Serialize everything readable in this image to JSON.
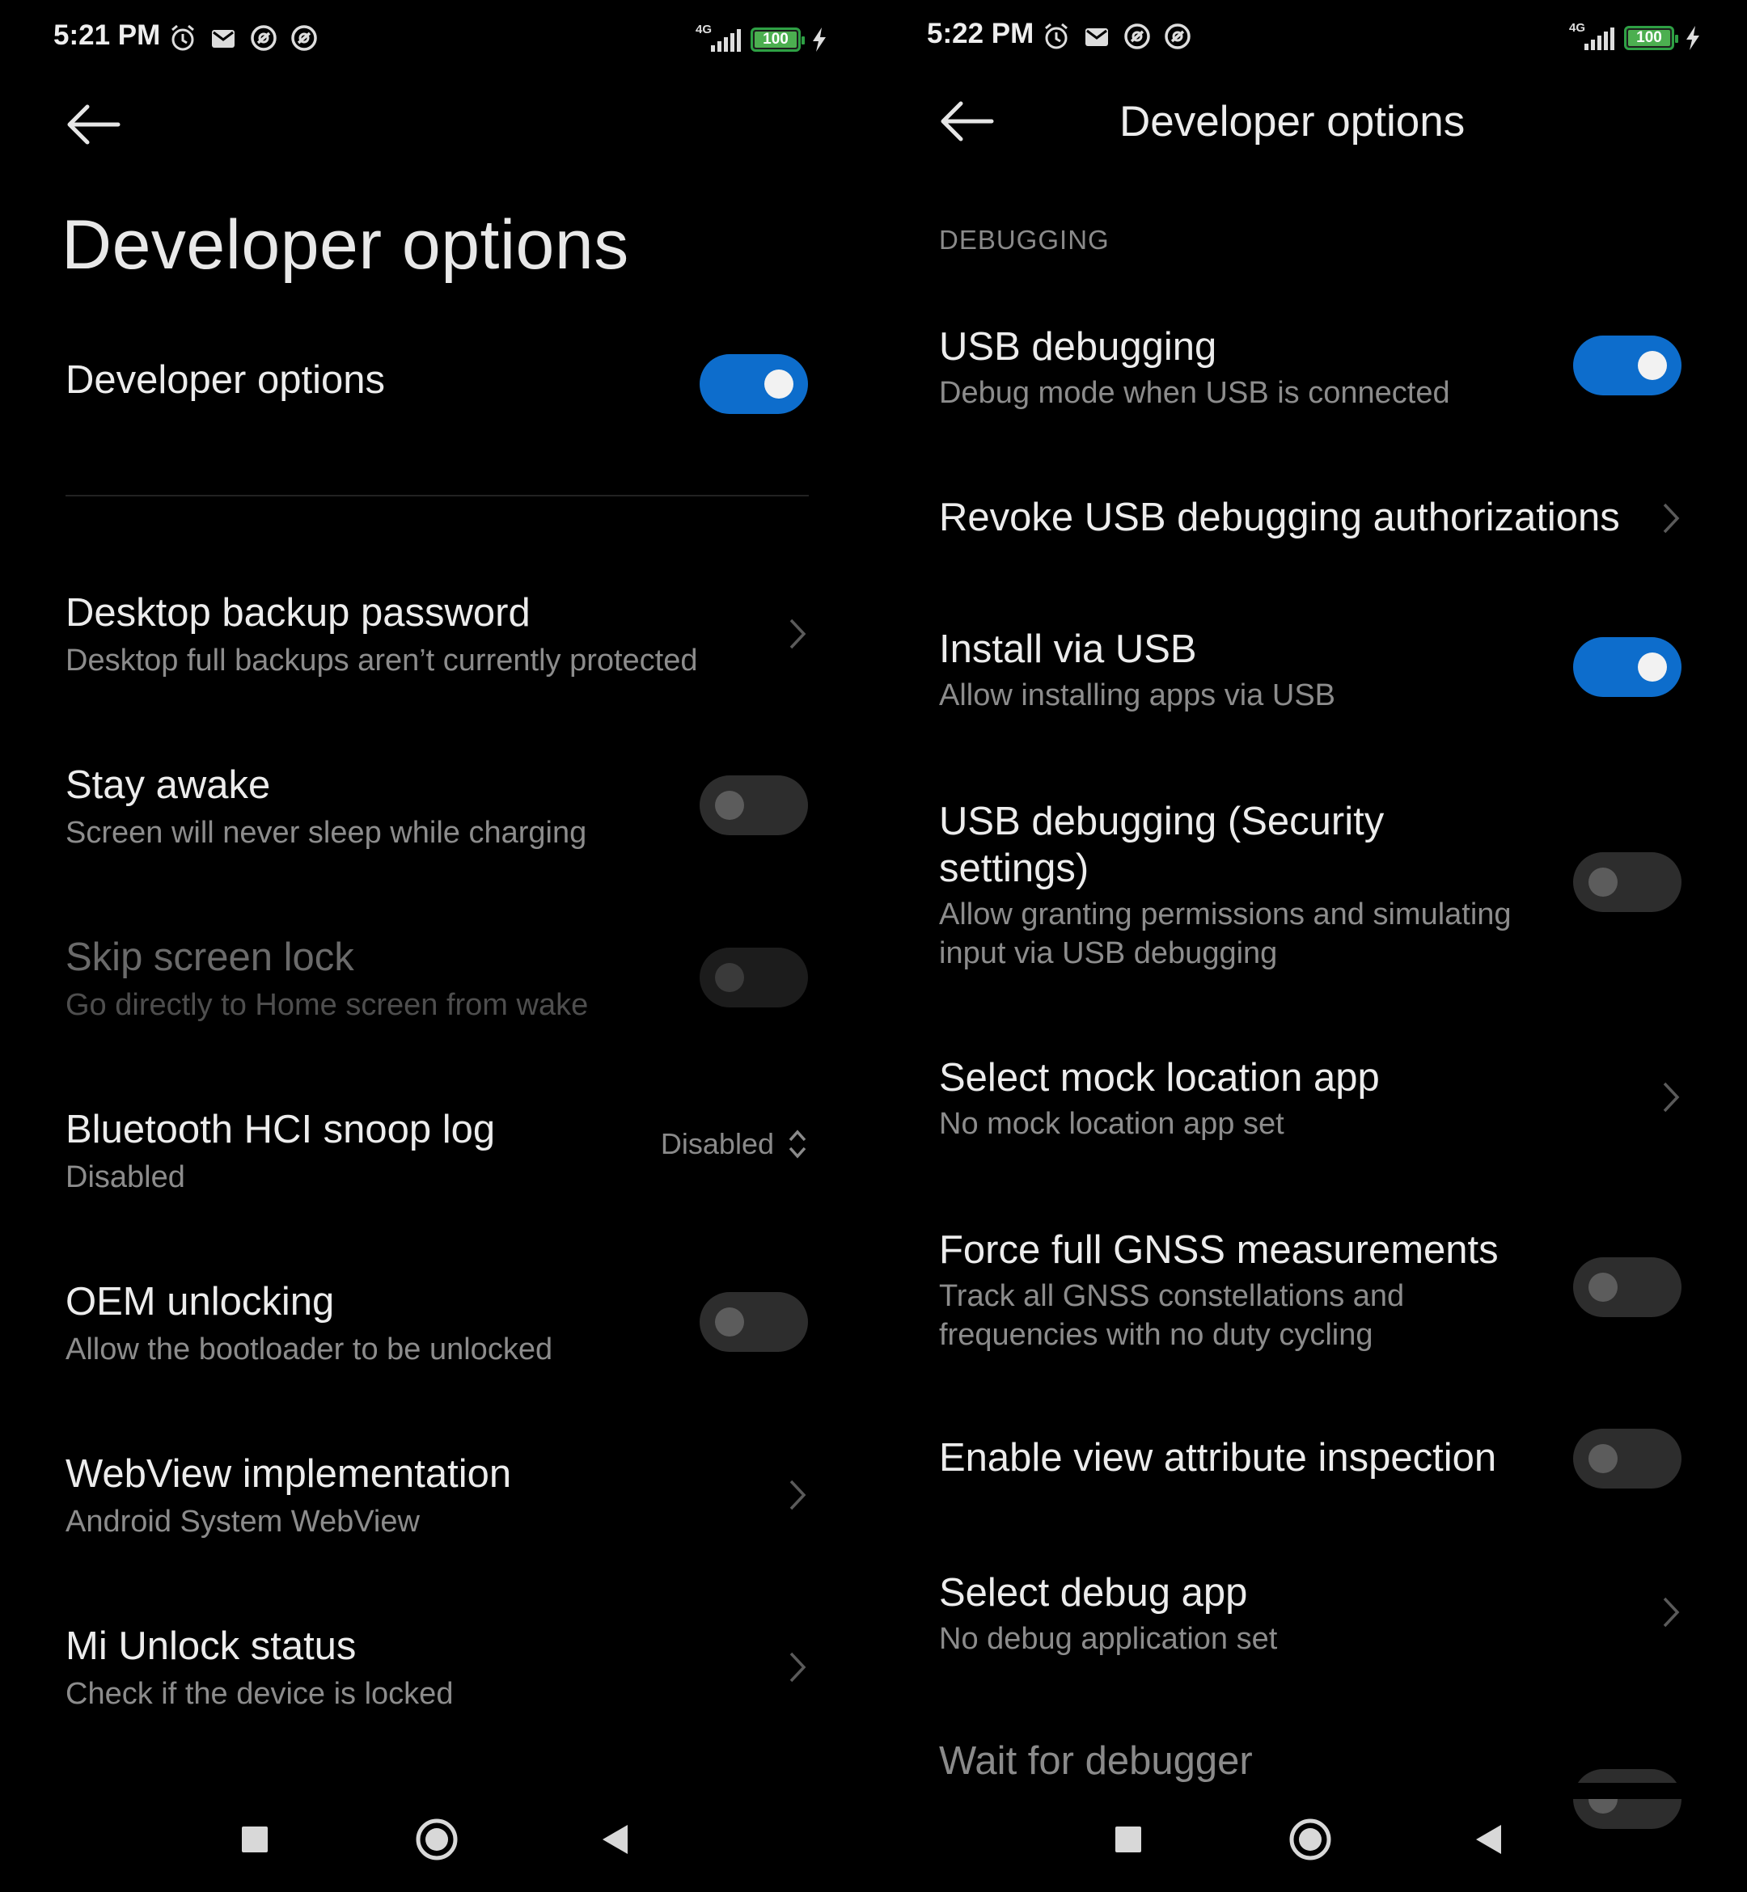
{
  "left": {
    "status": {
      "time": "5:21 PM",
      "network": "4G",
      "battery": "100"
    },
    "header": {
      "title": "Developer options"
    },
    "master_toggle": {
      "label": "Developer options",
      "on": true
    },
    "items": [
      {
        "label": "Desktop backup password",
        "sub": "Desktop full backups aren’t currently protected"
      },
      {
        "label": "Stay awake",
        "sub": "Screen will never sleep while charging",
        "on": false
      },
      {
        "label": "Skip screen lock",
        "sub": "Go directly to Home screen from wake",
        "on": false
      },
      {
        "label": "Bluetooth HCI snoop log",
        "sub": "Disabled",
        "value": "Disabled"
      },
      {
        "label": "OEM unlocking",
        "sub": "Allow the bootloader to be unlocked",
        "on": false
      },
      {
        "label": "WebView implementation",
        "sub": "Android System WebView"
      },
      {
        "label": "Mi Unlock status",
        "sub": "Check if the device is locked"
      }
    ]
  },
  "right": {
    "status": {
      "time": "5:22 PM",
      "network": "4G",
      "battery": "100"
    },
    "header": {
      "title": "Developer options"
    },
    "section": "DEBUGGING",
    "items": [
      {
        "label": "USB debugging",
        "sub": "Debug mode when USB is connected",
        "on": true
      },
      {
        "label": "Revoke USB debugging authorizations"
      },
      {
        "label": "Install via USB",
        "sub": "Allow installing apps via USB",
        "on": true
      },
      {
        "label_line1": "USB debugging (Security",
        "label_line2": "settings)",
        "sub_line1": "Allow granting permissions and simulating",
        "sub_line2": "input via USB debugging",
        "on": false
      },
      {
        "label": "Select mock location app",
        "sub": "No mock location app set"
      },
      {
        "label": "Force full GNSS measurements",
        "sub_line1": "Track all GNSS constellations and",
        "sub_line2": "frequencies with no duty cycling",
        "on": false
      },
      {
        "label": "Enable view attribute inspection",
        "on": false
      },
      {
        "label": "Select debug app",
        "sub": "No debug application set"
      },
      {
        "label": "Wait for debugger"
      }
    ]
  },
  "colors": {
    "accent": "#0d6dcc",
    "background": "#000000",
    "battery": "#4caf50"
  },
  "icons": [
    "alarm-icon",
    "mail-icon",
    "sync-icon",
    "back-arrow-icon",
    "chevron-right-icon",
    "updown-chevron-icon",
    "recents-icon",
    "home-icon",
    "back-triangle-icon"
  ]
}
